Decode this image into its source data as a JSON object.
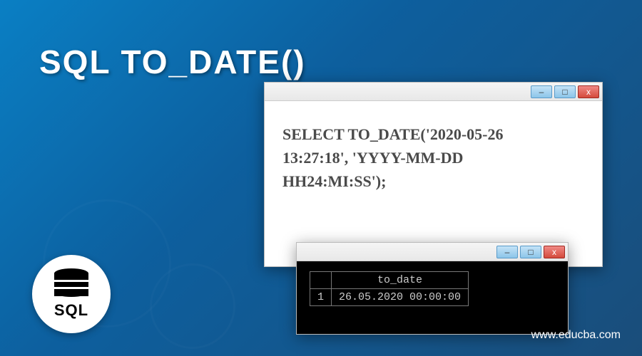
{
  "title": "SQL TO_DATE()",
  "code": {
    "line1": "SELECT TO_DATE('2020-05-26",
    "line2": "13:27:18', 'YYYY-MM-DD",
    "line3": "HH24:MI:SS');"
  },
  "result": {
    "header": "to_date",
    "row_num": "1",
    "value": "26.05.2020 00:00:00"
  },
  "icon": {
    "label": "SQL"
  },
  "footer": "www.educba.com",
  "window_controls": {
    "minimize": "–",
    "maximize": "□",
    "close": "x"
  }
}
